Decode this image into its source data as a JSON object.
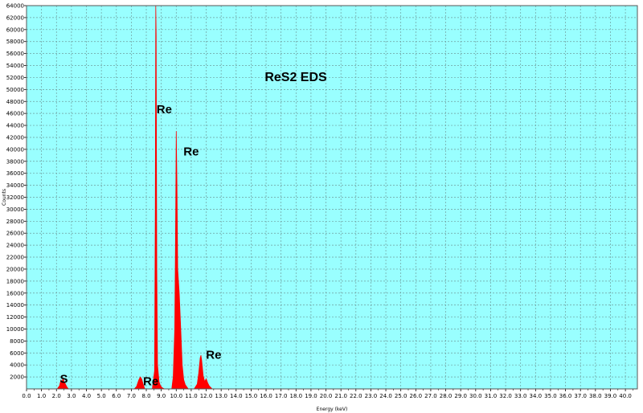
{
  "chart_data": {
    "type": "area",
    "title": "ReS2 EDS",
    "xlabel": "Energy (keV)",
    "ylabel": "Counts",
    "xlim": [
      0,
      40.8
    ],
    "ylim": [
      0,
      64000
    ],
    "x_ticks": [
      "0.0",
      "1.0",
      "2.0",
      "3.0",
      "4.0",
      "5.0",
      "6.0",
      "7.0",
      "8.0",
      "9.0",
      "10.0",
      "11.0",
      "12.0",
      "13.0",
      "14.0",
      "15.0",
      "16.0",
      "17.0",
      "18.0",
      "19.0",
      "20.0",
      "21.0",
      "22.0",
      "23.0",
      "24.0",
      "25.0",
      "26.0",
      "27.0",
      "28.0",
      "29.0",
      "30.0",
      "31.0",
      "32.0",
      "33.0",
      "34.0",
      "35.0",
      "36.0",
      "37.0",
      "38.0",
      "39.0",
      "40.0"
    ],
    "y_ticks": [
      "2000",
      "4000",
      "6000",
      "8000",
      "10000",
      "12000",
      "14000",
      "16000",
      "18000",
      "20000",
      "22000",
      "24000",
      "26000",
      "28000",
      "30000",
      "32000",
      "34000",
      "36000",
      "38000",
      "40000",
      "42000",
      "44000",
      "46000",
      "48000",
      "50000",
      "52000",
      "54000",
      "56000",
      "58000",
      "60000",
      "62000",
      "64000"
    ],
    "grid": true,
    "colors": {
      "background": "#99ffff",
      "fill": "#ff0000",
      "grid": "#6f9e9e"
    },
    "series": [
      {
        "x": [
          2.05,
          2.2,
          2.3,
          2.35,
          2.45,
          2.5,
          2.6,
          2.7,
          2.8,
          2.9,
          7.2,
          7.35,
          7.5,
          7.6,
          7.7,
          7.8,
          7.9,
          8.4,
          8.55,
          8.6,
          8.63,
          8.66,
          8.7,
          8.75,
          8.85,
          8.95,
          9.05,
          9.2,
          9.35,
          9.7,
          9.8,
          9.9,
          9.95,
          10.0,
          10.05,
          10.1,
          10.2,
          10.3,
          10.4,
          10.5,
          10.6,
          10.8,
          11.2,
          11.4,
          11.5,
          11.6,
          11.65,
          11.7,
          11.8,
          11.9,
          12.0,
          12.1,
          12.2,
          12.4
        ],
        "y": [
          0,
          500,
          1500,
          1000,
          1800,
          1200,
          800,
          300,
          0,
          0,
          0,
          400,
          1500,
          2000,
          1600,
          700,
          0,
          0,
          3000,
          30000,
          64000,
          59000,
          20000,
          4000,
          1200,
          500,
          200,
          0,
          0,
          0,
          2000,
          10000,
          24000,
          43000,
          34000,
          20000,
          16000,
          10000,
          4000,
          1500,
          700,
          0,
          0,
          800,
          2600,
          5200,
          5600,
          4800,
          2200,
          1200,
          1700,
          1000,
          500,
          0
        ]
      }
    ],
    "annotations": [
      {
        "text": "S",
        "x": 2.5,
        "y": 1000
      },
      {
        "text": "Re",
        "x": 9.2,
        "y": 46000
      },
      {
        "text": "Re",
        "x": 11.0,
        "y": 39000
      },
      {
        "text": "Re",
        "x": 8.3,
        "y": 600
      },
      {
        "text": "Re",
        "x": 12.5,
        "y": 5000
      }
    ]
  }
}
